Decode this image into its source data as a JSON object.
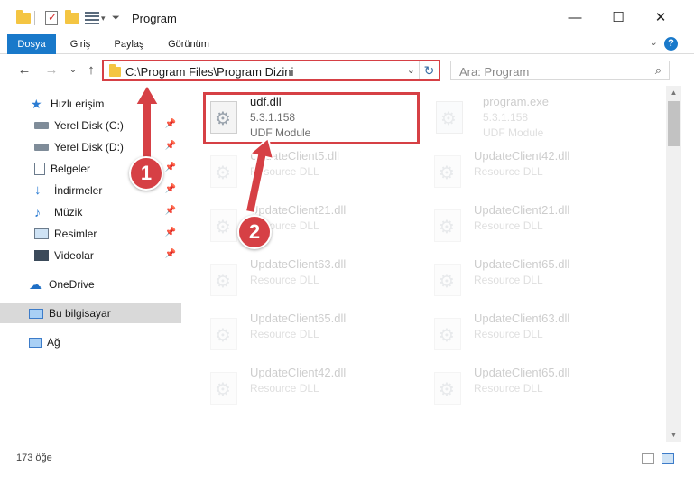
{
  "window": {
    "title": "Program",
    "controls": {
      "minimize": "—",
      "maximize": "☐",
      "close": "✕"
    }
  },
  "ribbon": {
    "tabs": [
      {
        "label": "Dosya",
        "active": true
      },
      {
        "label": "Giriş"
      },
      {
        "label": "Paylaş"
      },
      {
        "label": "Görünüm"
      }
    ],
    "help": "?",
    "collapse": "⌄"
  },
  "nav": {
    "back": "←",
    "forward": "→",
    "recent": "⌄",
    "up": "↑",
    "address": "C:\\Program Files\\Program Dizini",
    "address_dropdown": "⌄",
    "refresh": "↻",
    "search_placeholder": "Ara: Program",
    "search_icon": "⌕"
  },
  "sidebar": {
    "items": [
      {
        "label": "Hızlı erişim",
        "icon": "star-icon"
      },
      {
        "label": "Yerel Disk (C:)",
        "icon": "drive-icon",
        "pinned": true
      },
      {
        "label": "Yerel Disk (D:)",
        "icon": "drive-icon",
        "pinned": true
      },
      {
        "label": "Belgeler",
        "icon": "documents-icon",
        "pinned": true
      },
      {
        "label": "İndirmeler",
        "icon": "download-icon",
        "pinned": true
      },
      {
        "label": "Müzik",
        "icon": "music-icon",
        "pinned": true
      },
      {
        "label": "Resimler",
        "icon": "pictures-icon",
        "pinned": true
      },
      {
        "label": "Videolar",
        "icon": "video-icon",
        "pinned": true
      },
      {
        "label": "OneDrive",
        "icon": "onedrive-icon"
      },
      {
        "label": "Bu bilgisayar",
        "icon": "computer-icon",
        "selected": true
      },
      {
        "label": "Ağ",
        "icon": "network-icon"
      }
    ],
    "pin_glyph": "📌"
  },
  "files": [
    {
      "name": "udf.dll",
      "version": "5.3.1.158",
      "desc": "UDF Module"
    },
    {
      "name": "program.exe",
      "version": "5.3.1.158",
      "desc": "UDF Module"
    },
    {
      "name": "UpdateClient5.dll",
      "desc": "Resource DLL"
    },
    {
      "name": "UpdateClient42.dll",
      "desc": "Resource DLL"
    },
    {
      "name": "UpdateClient21.dll",
      "desc": "Resource DLL"
    },
    {
      "name": "UpdateClient21.dll",
      "desc": "Resource DLL"
    },
    {
      "name": "UpdateClient63.dll",
      "desc": "Resource DLL"
    },
    {
      "name": "UpdateClient65.dll",
      "desc": "Resource DLL"
    },
    {
      "name": "UpdateClient65.dll",
      "desc": "Resource DLL"
    },
    {
      "name": "UpdateClient63.dll",
      "desc": "Resource DLL"
    },
    {
      "name": "UpdateClient42.dll",
      "desc": "Resource DLL"
    },
    {
      "name": "UpdateClient65.dll",
      "desc": "Resource DLL"
    }
  ],
  "status": {
    "count": "173 öğe"
  },
  "annotations": {
    "step1": "1",
    "step2": "2"
  },
  "colors": {
    "accent": "#1979ca",
    "annotation": "#d64045"
  }
}
